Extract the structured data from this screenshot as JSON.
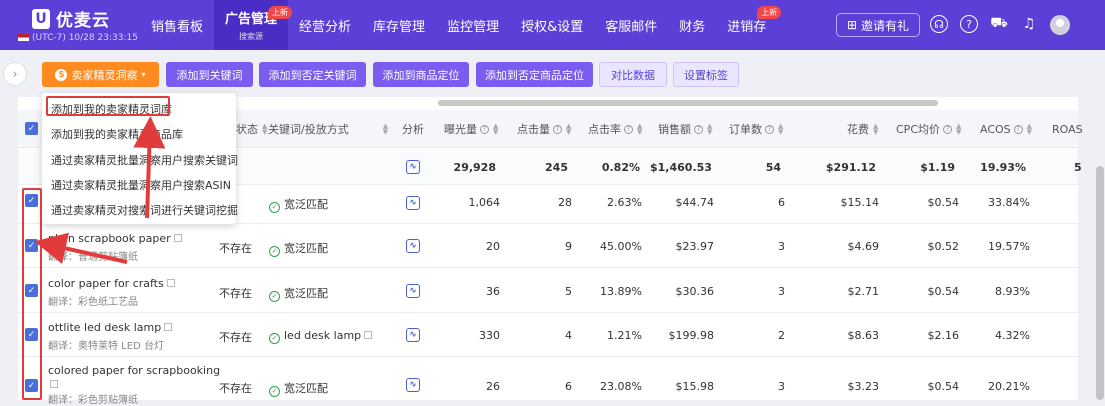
{
  "app": {
    "logo_mark": "U",
    "logo_text": "优麦云",
    "timezone": "(UTC-7) 10/28 23:33:15"
  },
  "nav": [
    {
      "label": "销售看板"
    },
    {
      "label": "广告管理",
      "badge": "上新",
      "sub": "搜索源",
      "active": true
    },
    {
      "label": "经营分析"
    },
    {
      "label": "库存管理"
    },
    {
      "label": "监控管理"
    },
    {
      "label": "授权&设置"
    },
    {
      "label": "客服邮件"
    },
    {
      "label": "财务"
    },
    {
      "label": "进销存",
      "badge": "上新"
    }
  ],
  "header": {
    "invite_label": "邀请有礼",
    "icons": [
      "headset-icon",
      "help-icon",
      "cart-icon",
      "bell-icon",
      "avatar"
    ]
  },
  "toolbar": {
    "seller_wizard": "卖家精灵洞察",
    "add_keyword": "添加到关键词",
    "add_negative_keyword": "添加到否定关键词",
    "add_product_target": "添加到商品定位",
    "add_negative_product_target": "添加到否定商品定位",
    "compare": "对比数据",
    "set_tags": "设置标签"
  },
  "dropdown": [
    "添加到我的卖家精灵词库",
    "添加到我的卖家精灵商品库",
    "通过卖家精灵批量洞察用户搜索关键词",
    "通过卖家精灵批量洞察用户搜索ASIN",
    "通过卖家精灵对搜索词进行关键词挖掘"
  ],
  "columns": {
    "status": "状态",
    "keyword": "关键词/投放方式",
    "analysis": "分析",
    "impressions": "曝光量",
    "clicks": "点击量",
    "ctr": "点击率",
    "sales": "销售额",
    "orders": "订单数",
    "spend": "花费",
    "cpc": "CPC均价",
    "acos": "ACOS",
    "roas": "ROAS"
  },
  "summary": {
    "impressions": "29,928",
    "clicks": "245",
    "ctr": "0.82%",
    "sales": "$1,460.53",
    "orders": "54",
    "spend": "$291.12",
    "cpc": "$1.19",
    "acos": "19.93%",
    "roas": "5"
  },
  "rows": [
    {
      "kw": "",
      "tr": "",
      "status": "",
      "match": "宽泛匹配",
      "impressions": "1,064",
      "clicks": "28",
      "ctr": "2.63%",
      "sales": "$44.74",
      "orders": "6",
      "spend": "$15.14",
      "cpc": "$0.54",
      "acos": "33.84%"
    },
    {
      "kw": "plain scrapbook paper",
      "tr": "翻译：普通剪贴簿纸",
      "status": "不存在",
      "match": "宽泛匹配",
      "impressions": "20",
      "clicks": "9",
      "ctr": "45.00%",
      "sales": "$23.97",
      "orders": "3",
      "spend": "$4.69",
      "cpc": "$0.52",
      "acos": "19.57%"
    },
    {
      "kw": "color paper for crafts",
      "tr": "翻译：彩色纸工艺品",
      "status": "不存在",
      "match": "宽泛匹配",
      "impressions": "36",
      "clicks": "5",
      "ctr": "13.89%",
      "sales": "$30.36",
      "orders": "3",
      "spend": "$2.71",
      "cpc": "$0.54",
      "acos": "8.93%"
    },
    {
      "kw": "ottlite led desk lamp",
      "tr": "翻译：奥特莱特 LED 台灯",
      "status": "不存在",
      "match": "led desk lamp",
      "impressions": "330",
      "clicks": "4",
      "ctr": "1.21%",
      "sales": "$199.98",
      "orders": "2",
      "spend": "$8.63",
      "cpc": "$2.16",
      "acos": "4.32%"
    },
    {
      "kw": "colored paper for scrapbooking",
      "tr": "翻译：彩色剪贴簿纸",
      "status": "不存在",
      "match": "宽泛匹配",
      "impressions": "26",
      "clicks": "6",
      "ctr": "23.08%",
      "sales": "$15.98",
      "orders": "3",
      "spend": "$3.23",
      "cpc": "$0.54",
      "acos": "20.21%"
    }
  ]
}
